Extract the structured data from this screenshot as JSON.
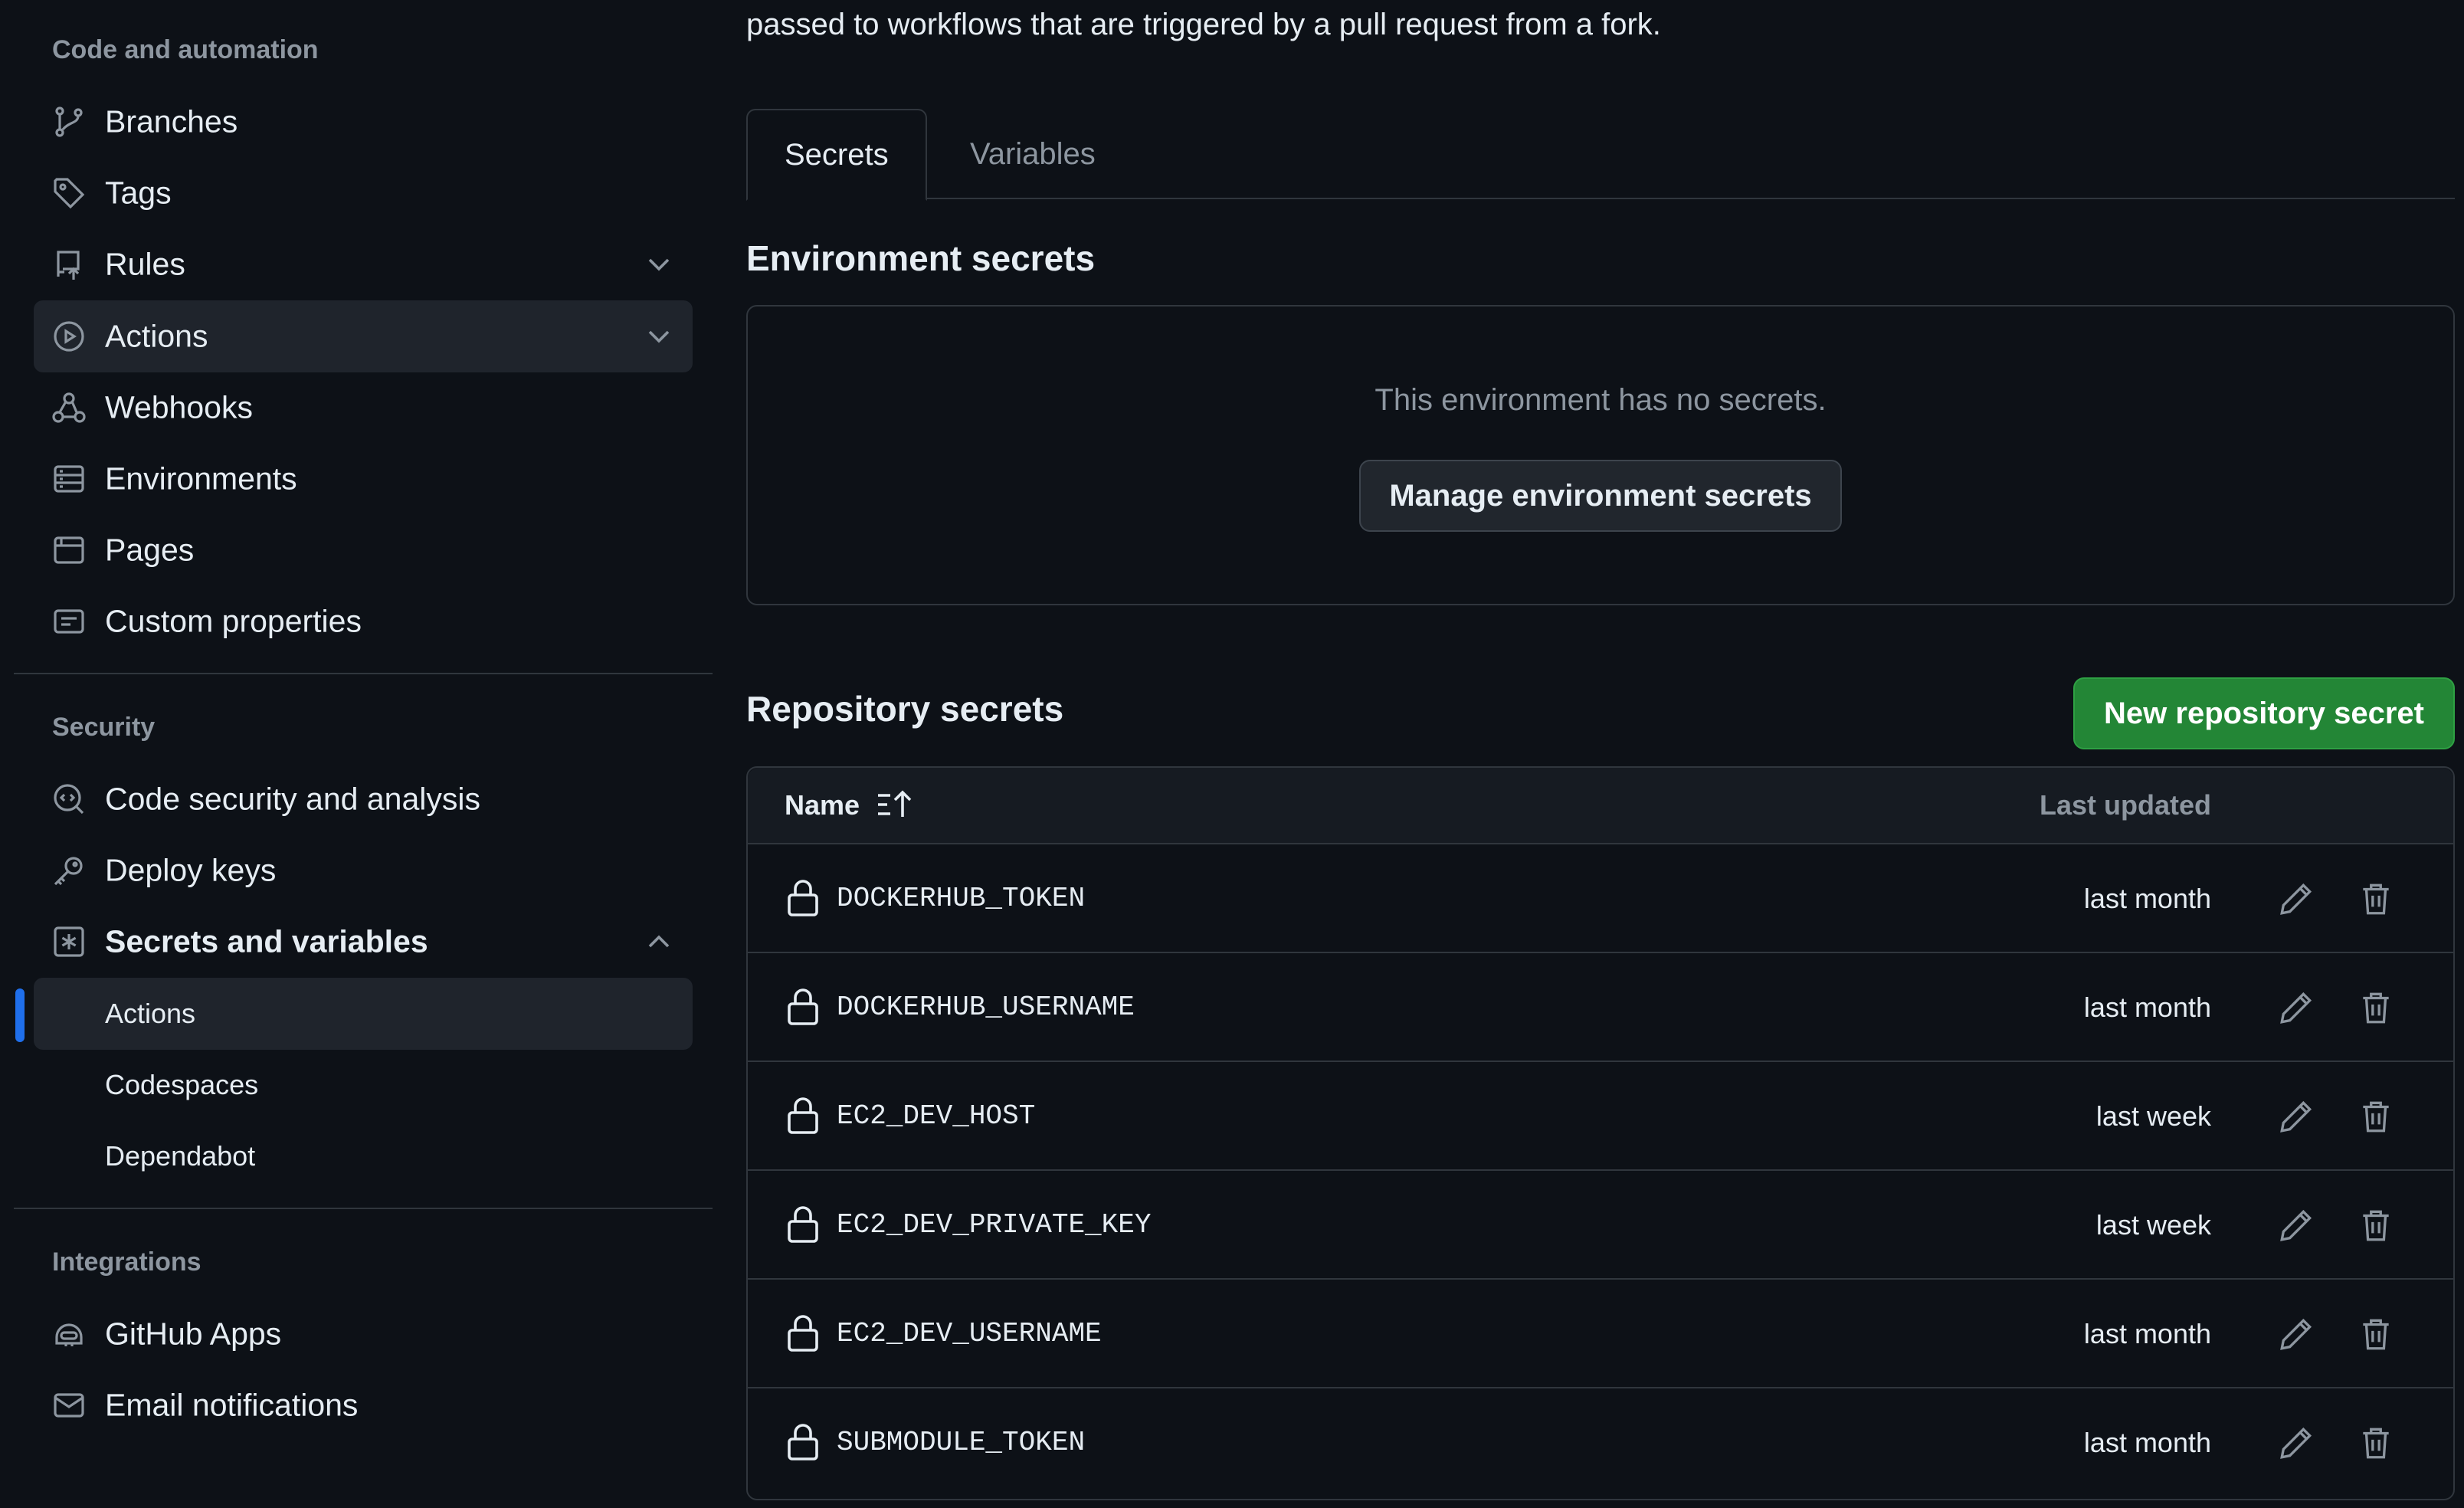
{
  "sidebar": {
    "group_code": "Code and automation",
    "group_security": "Security",
    "group_integrations": "Integrations",
    "items": {
      "branches": "Branches",
      "tags": "Tags",
      "rules": "Rules",
      "actions": "Actions",
      "webhooks": "Webhooks",
      "environments": "Environments",
      "pages": "Pages",
      "custom_properties": "Custom properties",
      "code_security": "Code security and analysis",
      "deploy_keys": "Deploy keys",
      "secrets_and_variables": "Secrets and variables",
      "sub_actions": "Actions",
      "sub_codespaces": "Codespaces",
      "sub_dependabot": "Dependabot",
      "github_apps": "GitHub Apps",
      "email_notifications": "Email notifications"
    }
  },
  "main": {
    "intro_text": "passed to workflows that are triggered by a pull request from a fork.",
    "tabs": [
      {
        "label": "Secrets",
        "active": true
      },
      {
        "label": "Variables",
        "active": false
      }
    ],
    "env_secrets": {
      "title": "Environment secrets",
      "empty_text": "This environment has no secrets.",
      "manage_button": "Manage environment secrets"
    },
    "repo_secrets": {
      "title": "Repository secrets",
      "new_button": "New repository secret",
      "columns": {
        "name": "Name",
        "updated": "Last updated"
      },
      "rows": [
        {
          "name": "DOCKERHUB_TOKEN",
          "updated": "last month"
        },
        {
          "name": "DOCKERHUB_USERNAME",
          "updated": "last month"
        },
        {
          "name": "EC2_DEV_HOST",
          "updated": "last week"
        },
        {
          "name": "EC2_DEV_PRIVATE_KEY",
          "updated": "last week"
        },
        {
          "name": "EC2_DEV_USERNAME",
          "updated": "last month"
        },
        {
          "name": "SUBMODULE_TOKEN",
          "updated": "last month"
        }
      ]
    }
  },
  "colors": {
    "background": "#0d1117",
    "accent_blue": "#1f6feb",
    "primary_green": "#238636",
    "muted_text": "#8d96a0",
    "border": "#30363d"
  }
}
